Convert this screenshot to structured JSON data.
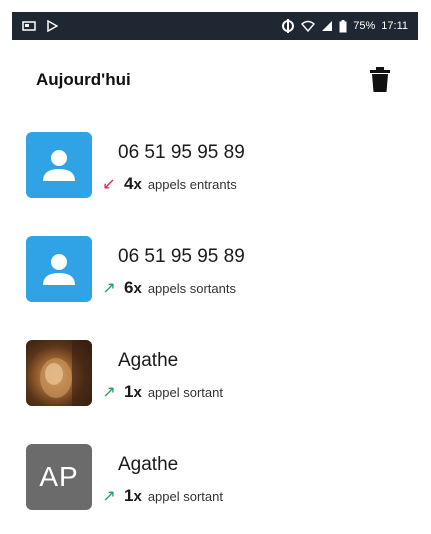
{
  "status_bar": {
    "battery": "75%",
    "time": "17:11",
    "icons": [
      "screenshot-icon",
      "play-store-icon",
      "data-sync-icon",
      "wifi-icon",
      "signal-icon",
      "battery-icon"
    ]
  },
  "header": {
    "title": "Aujourd'hui",
    "delete_icon": "trash-icon"
  },
  "calls": [
    {
      "name": "06 51 95 95 89",
      "avatar_type": "placeholder",
      "direction": "incoming",
      "arrow": "↙",
      "arrow_color": "#e0245e",
      "count": "4",
      "x": "x",
      "type_label": "appels entrants"
    },
    {
      "name": "06 51 95 95 89",
      "avatar_type": "placeholder",
      "direction": "outgoing",
      "arrow": "↗",
      "arrow_color": "#1aa260",
      "count": "6",
      "x": "x",
      "type_label": "appels sortants"
    },
    {
      "name": "Agathe",
      "avatar_type": "photo",
      "direction": "outgoing",
      "arrow": "↗",
      "arrow_color": "#1aa260",
      "count": "1",
      "x": "x",
      "type_label": "appel sortant"
    },
    {
      "name": "Agathe",
      "avatar_type": "initials",
      "initials": "AP",
      "direction": "outgoing",
      "arrow": "↗",
      "arrow_color": "#1aa260",
      "count": "1",
      "x": "x",
      "type_label": "appel sortant"
    }
  ],
  "colors": {
    "status_bar_bg": "#1f2733",
    "avatar_blue": "#2fa3e6",
    "avatar_gray": "#6b6b6b",
    "incoming": "#e0245e",
    "outgoing": "#1aa260"
  }
}
